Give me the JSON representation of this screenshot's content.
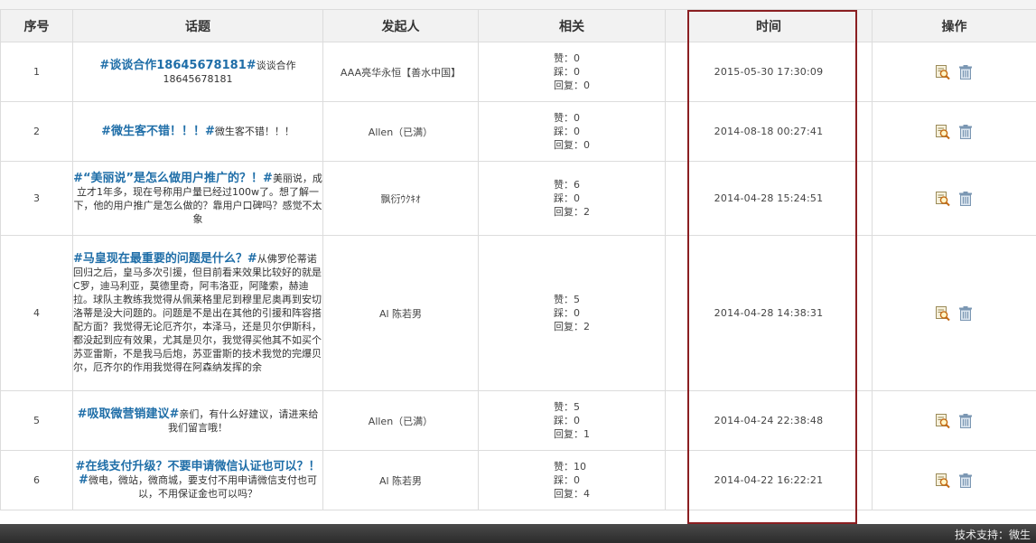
{
  "table": {
    "headers": {
      "seq": "序号",
      "topic": "话题",
      "initiator": "发起人",
      "related": "相关",
      "time": "时间",
      "actions": "操作"
    },
    "related_labels": {
      "likes": "赞：",
      "dislikes": "踩：",
      "replies": "回复："
    },
    "rows": [
      {
        "index": "1",
        "title": "#谈谈合作18645678181#",
        "body": "谈谈合作18645678181",
        "initiator": "AAA亮华永恒【善水中国】",
        "likes": "0",
        "dislikes": "0",
        "replies": "0",
        "time": "2015-05-30 17:30:09"
      },
      {
        "index": "2",
        "title": "#微生客不错！！！#",
        "body": "微生客不错！！！",
        "initiator": "Allen（已满）",
        "likes": "0",
        "dislikes": "0",
        "replies": "0",
        "time": "2014-08-18 00:27:41"
      },
      {
        "index": "3",
        "title": "#“美丽说”是怎么做用户推广的？！#",
        "body": "美丽说，成立才1年多，现在号称用户量已经过100w了。想了解一下，他的用户推广是怎么做的？靠用户口碑吗？感觉不太象",
        "initiator": "飘衍ｳｸｷｵ",
        "likes": "6",
        "dislikes": "0",
        "replies": "2",
        "time": "2014-04-28 15:24:51"
      },
      {
        "index": "4",
        "title": "#马皇现在最重要的问题是什么？#",
        "body": "从佛罗伦蒂诺回归之后，皇马多次引援，但目前看来效果比较好的就是C罗，迪马利亚，莫德里奇，阿韦洛亚，阿隆索，赫迪拉。球队主教练我觉得从佩莱格里尼到穆里尼奥再到安切洛蒂是没大问题的。问题是不是出在其他的引援和阵容搭配方面？我觉得无论厄齐尔，本泽马，还是贝尔伊斯科，都没起到应有效果，尤其是贝尔，我觉得买他其不如买个苏亚雷斯，不是我马后炮，苏亚雷斯的技术我觉的完爆贝尔，厄齐尔的作用我觉得在阿森纳发挥的余",
        "initiator": "Al 陈若男",
        "likes": "5",
        "dislikes": "0",
        "replies": "2",
        "time": "2014-04-28 14:38:31"
      },
      {
        "index": "5",
        "title": "#吸取微营销建议#",
        "body": "亲们，有什么好建议，请进来给我们留言哦！",
        "initiator": "Allen（已满）",
        "likes": "5",
        "dislikes": "0",
        "replies": "1",
        "time": "2014-04-24 22:38:48"
      },
      {
        "index": "6",
        "title": "#在线支付升级？不要申请微信认证也可以？！#",
        "body": "微电，微站，微商城，要支付不用申请微信支付也可以，不用保证金也可以吗？",
        "initiator": "Al 陈若男",
        "likes": "10",
        "dislikes": "0",
        "replies": "4",
        "time": "2014-04-22 16:22:21"
      }
    ]
  },
  "icons": {
    "view": "view-magnifier-icon",
    "delete": "trash-icon"
  },
  "colors": {
    "title": "#1f6ea8",
    "highlight": "#8b1f22",
    "footer": "#333333"
  },
  "footer": {
    "text": "技术支持：微生"
  }
}
